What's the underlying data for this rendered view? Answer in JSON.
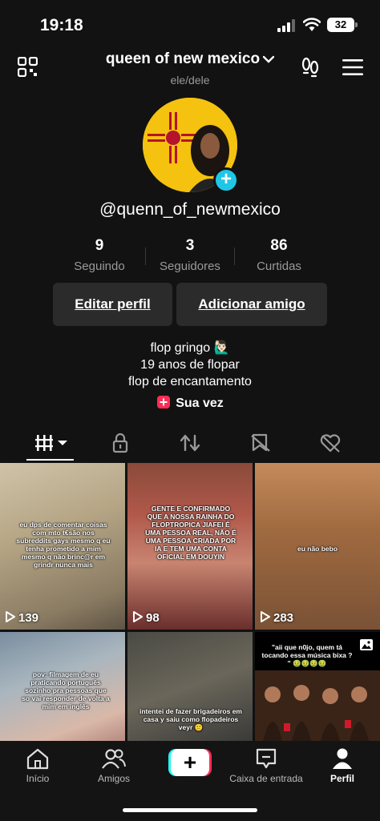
{
  "status_bar": {
    "time": "19:18",
    "battery": "32"
  },
  "header": {
    "title": "queen of new mexico",
    "pronouns": "ele/dele"
  },
  "profile": {
    "handle": "@quenn_of_newmexico"
  },
  "stats": [
    {
      "value": "9",
      "label": "Seguindo"
    },
    {
      "value": "3",
      "label": "Seguidores"
    },
    {
      "value": "86",
      "label": "Curtidas"
    }
  ],
  "buttons": {
    "edit": "Editar perfil",
    "add_friend": "Adicionar amigo"
  },
  "bio": {
    "line1": "flop gringo 🙋🏻‍♂️",
    "line2": "19 anos de flopar",
    "line3": "flop de encantamento"
  },
  "sua_vez": "Sua vez",
  "videos": [
    {
      "caption": "eu dps de comentar coisas com mto t€são nos subreddits gays mesmo q eu tenha prometido a mim mesmo q não brinc@r em grindr nunca mais",
      "views": "139"
    },
    {
      "caption": "GENTE E CONFIRMADO QUE A NOSSA RAINHA DO FLOPTROPICA JIAFEI É UMA PESSOA REAL, NÃO É UMA PESSOA CRIADA POR IA E TEM UMA CONTA OFICIAL EM DOUYIN",
      "views": "98"
    },
    {
      "caption": "eu não bebo",
      "views": "283"
    },
    {
      "caption": "pov: filmagem de eu praticando português sozinho pra pessoas que so vai responder de volta a mim em inglês",
      "views": ""
    },
    {
      "caption": "intentei de fazer brigadeiros em casa y saiu como flopadeiros veyr 🙂",
      "views": ""
    },
    {
      "caption": "\"aii que n0jo, quem tá tocando essa música bixa ? \" 🤢🤢🤢🤢",
      "views": ""
    }
  ],
  "nav": {
    "home": "Início",
    "friends": "Amigos",
    "inbox": "Caixa de entrada",
    "profile": "Perfil"
  },
  "colors": {
    "background": "#121212",
    "accent_cyan": "#20c6e6",
    "accent_red": "#fe2c55"
  }
}
